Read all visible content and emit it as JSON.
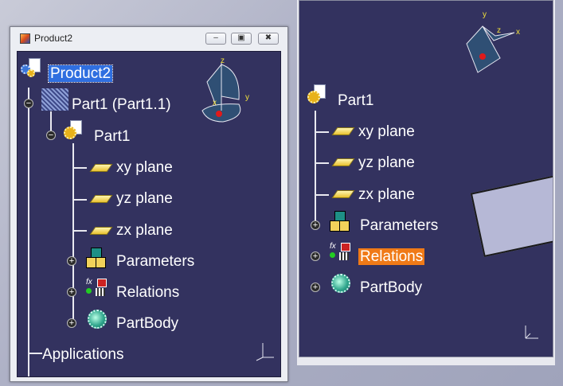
{
  "window": {
    "title": "Product2",
    "minimize": "‒",
    "maximize": "▣",
    "close": "✖"
  },
  "left_tree": {
    "root": "Product2",
    "part_instance": "Part1 (Part1.1)",
    "part": "Part1",
    "xy": "xy plane",
    "yz": "yz plane",
    "zx": "zx plane",
    "parameters": "Parameters",
    "relations": "Relations",
    "partbody": "PartBody",
    "applications": "Applications"
  },
  "right_tree": {
    "part": "Part1",
    "xy": "xy plane",
    "yz": "yz plane",
    "zx": "zx plane",
    "parameters": "Parameters",
    "relations": "Relations",
    "partbody": "PartBody"
  },
  "axes": {
    "x": "x",
    "y": "y",
    "z": "z"
  },
  "colors": {
    "background": "#33325f",
    "selection_blue": "#2f6fe0",
    "selection_orange": "#f07a17"
  }
}
